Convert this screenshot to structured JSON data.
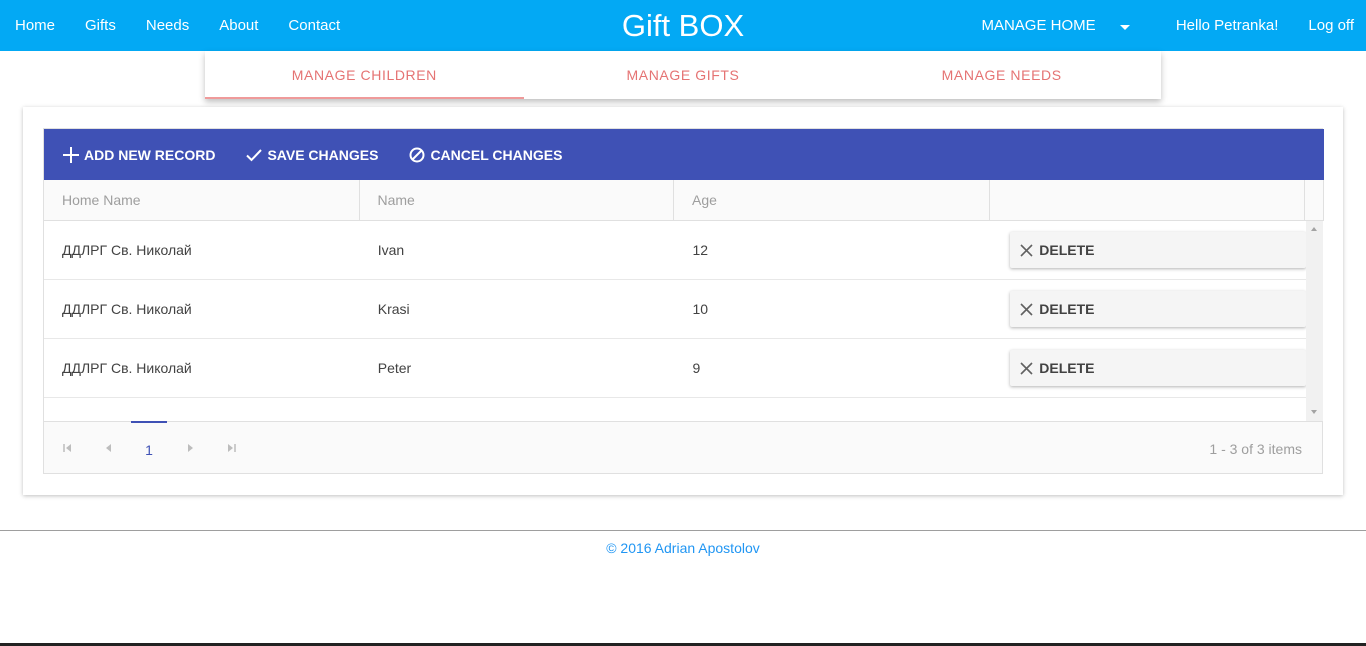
{
  "nav": {
    "links": [
      "Home",
      "Gifts",
      "Needs",
      "About",
      "Contact"
    ],
    "brand": "Gift BOX",
    "manage_home": "MANAGE HOME",
    "hello": "Hello Petranka!",
    "logoff": "Log off"
  },
  "tabs": [
    "MANAGE CHILDREN",
    "MANAGE GIFTS",
    "MANAGE NEEDS"
  ],
  "toolbar": {
    "add": "ADD NEW RECORD",
    "save": "SAVE CHANGES",
    "cancel": "CANCEL CHANGES"
  },
  "columns": [
    "Home Name",
    "Name",
    "Age",
    ""
  ],
  "rows": [
    {
      "home": "ДДЛРГ Св. Николай",
      "name": "Ivan",
      "age": "12",
      "action": "DELETE"
    },
    {
      "home": "ДДЛРГ Св. Николай",
      "name": "Krasi",
      "age": "10",
      "action": "DELETE"
    },
    {
      "home": "ДДЛРГ Св. Николай",
      "name": "Peter",
      "age": "9",
      "action": "DELETE"
    }
  ],
  "pager": {
    "current_page": "1",
    "info": "1 - 3 of 3 items"
  },
  "footer": "© 2016 Adrian Apostolov",
  "colors": {
    "navbar": "#03a9f4",
    "toolbar": "#3f51b5",
    "tab_text": "#e57373",
    "footer_link": "#2196f3"
  }
}
